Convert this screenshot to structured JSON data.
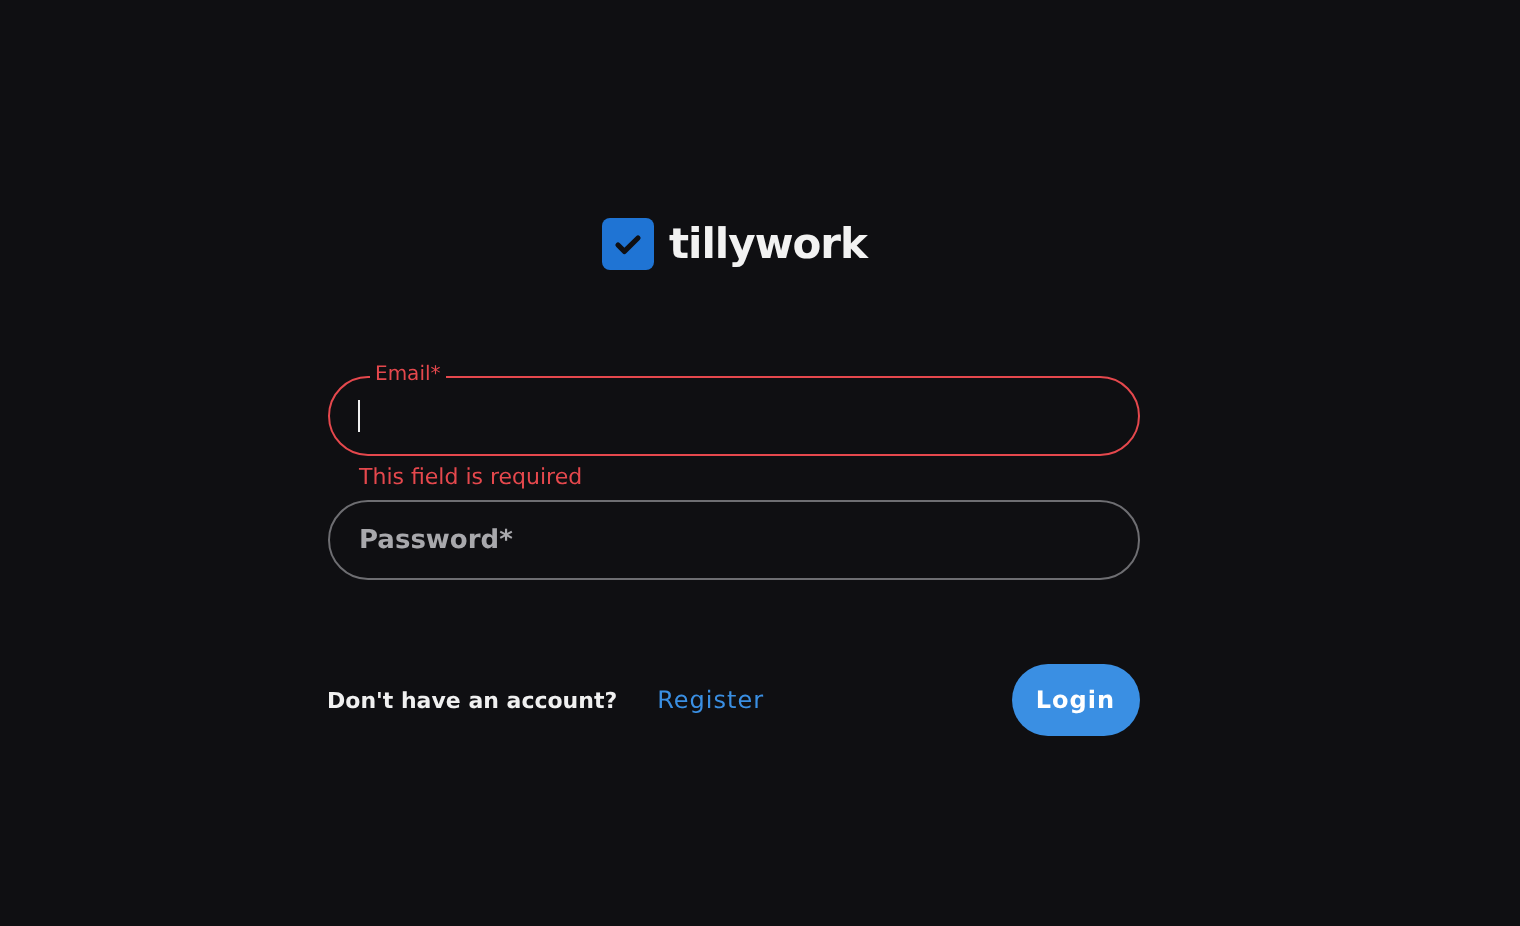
{
  "logo": {
    "text": "tillywork"
  },
  "fields": [
    {
      "label": "Email*",
      "focused": true,
      "error": true,
      "error_text": "This field is required"
    },
    {
      "placeholder": "Password*",
      "focused": false,
      "error": false
    }
  ],
  "footer": {
    "prompt": "Don't have an account?",
    "link": "Register",
    "button": "Login"
  }
}
